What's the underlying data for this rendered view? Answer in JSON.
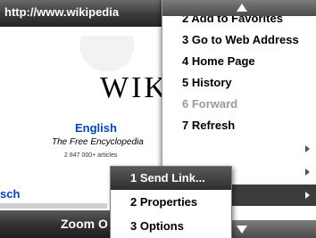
{
  "address_bar": {
    "url": "http://www.wikipedia"
  },
  "page": {
    "wordmark": "WIKI",
    "language_link": "English",
    "tagline": "The Free Encyclopedia",
    "article_count": "2 847 000+ articles",
    "partial_link": "sch"
  },
  "softkeys": {
    "left": "Zoom O"
  },
  "menu": {
    "items": [
      {
        "label": "2 Add to Favorites",
        "state": "normal"
      },
      {
        "label": "3 Go to Web Address",
        "state": "normal"
      },
      {
        "label": "4 Home Page",
        "state": "normal"
      },
      {
        "label": "5 History",
        "state": "normal"
      },
      {
        "label": "6 Forward",
        "state": "disabled"
      },
      {
        "label": "7 Refresh",
        "state": "normal"
      },
      {
        "label": "",
        "state": "normal",
        "submenu": true
      },
      {
        "label": "",
        "state": "normal",
        "submenu": true
      },
      {
        "label": "",
        "state": "highlighted",
        "submenu": true
      }
    ]
  },
  "submenu": {
    "items": [
      {
        "label": "1 Send Link...",
        "state": "highlighted"
      },
      {
        "label": "2 Properties",
        "state": "normal"
      },
      {
        "label": "3 Options",
        "state": "normal"
      }
    ]
  },
  "colors": {
    "bar_dark": "#262626",
    "highlight": "#3c3c3c",
    "link_blue": "#0645ad",
    "disabled_text": "#9a9a9a"
  },
  "icons": {
    "scroll_up": "triangle-up-icon",
    "scroll_down": "triangle-down-icon",
    "submenu": "triangle-right-icon"
  }
}
